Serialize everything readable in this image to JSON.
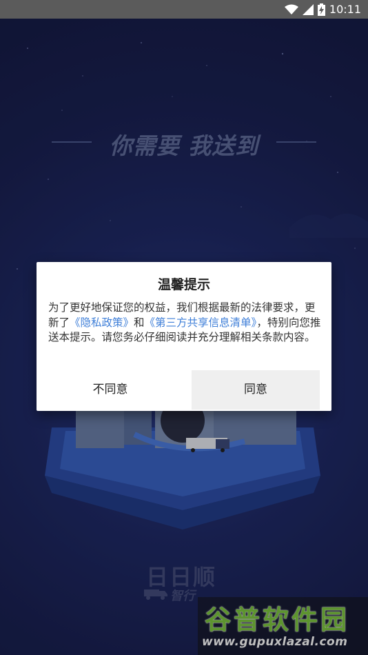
{
  "status_bar": {
    "time": "10:11",
    "icons": [
      "wifi-icon",
      "cellular-signal-icon",
      "battery-charging-icon"
    ]
  },
  "splash": {
    "slogan": "你需要 我送到",
    "brand_name": "日日顺",
    "brand_sub": "智行"
  },
  "watermark": {
    "title": "谷普软件园",
    "url": "www.gupuxlazal.com"
  },
  "dialog": {
    "title": "温馨提示",
    "body_part1": "为了更好地保证您的权益，我们根据最新的法律要求，更新了",
    "privacy_link": "《隐私政策》",
    "body_and": "和",
    "third_party_link": "《第三方共享信息清单》",
    "body_part2": "，特别向您推送本提示。请您务必仔细阅读并充分理解相关条款内容。",
    "disagree_label": "不同意",
    "agree_label": "同意"
  },
  "colors": {
    "background": "#1b2454",
    "link": "#3f7fd8",
    "agree_button_bg": "#efefef",
    "watermark_green": "#7cc63f"
  }
}
